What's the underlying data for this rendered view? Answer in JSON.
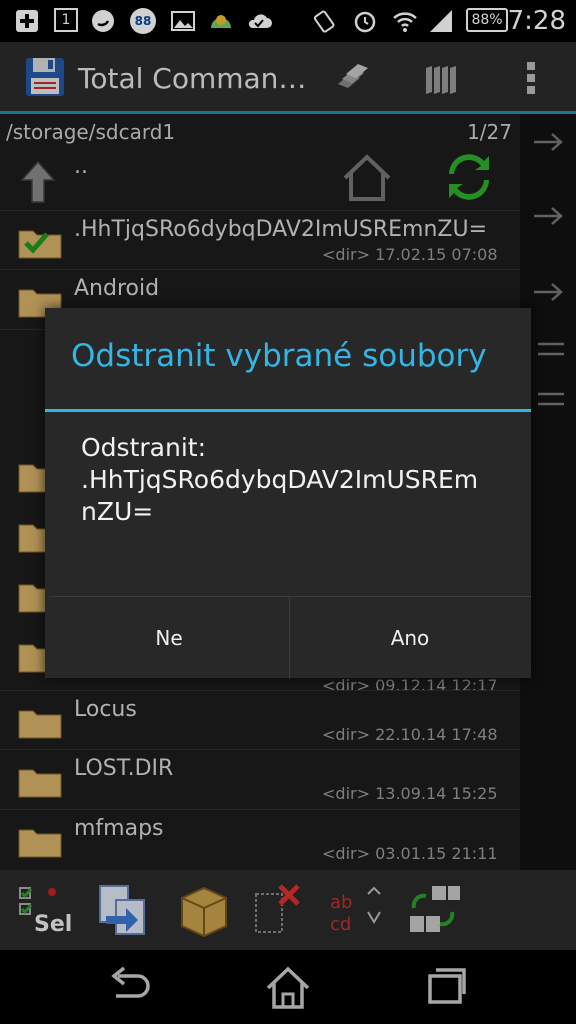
{
  "status_bar": {
    "time": "7:28",
    "battery": "88%",
    "badge": "88",
    "notif_box": "1"
  },
  "app": {
    "title": "Total Comman…"
  },
  "panel": {
    "path": "/storage/sdcard1",
    "count": "1/27",
    "parent_label": "..",
    "rows": [
      {
        "name": ".HhTjqSRo6dybqDAV2ImUSREmnZU=",
        "meta": "<dir> 17.02.15  07:08"
      },
      {
        "name": "Android",
        "meta": ""
      },
      {
        "name": "Locus",
        "meta": "<dir> 22.10.14  17:48"
      },
      {
        "name": "LOST.DIR",
        "meta": "<dir> 13.09.14  15:25"
      },
      {
        "name": "mfmaps",
        "meta": "<dir> 03.01.15  21:11"
      }
    ],
    "partial_meta": "<dir>  09.12.14  12:17"
  },
  "toolbar": {
    "sel_label": "Sel"
  },
  "dialog": {
    "title": "Odstranit vybrané soubory",
    "message_line1": "Odstranit:",
    "message_line2": ".HhTjqSRo6dybqDAV2ImUSREm",
    "message_line3": "nZU=",
    "no_label": "Ne",
    "yes_label": "Ano"
  },
  "colors": {
    "accent": "#33b5e5",
    "folder": "#d7b36a",
    "check": "#2aa02a"
  }
}
